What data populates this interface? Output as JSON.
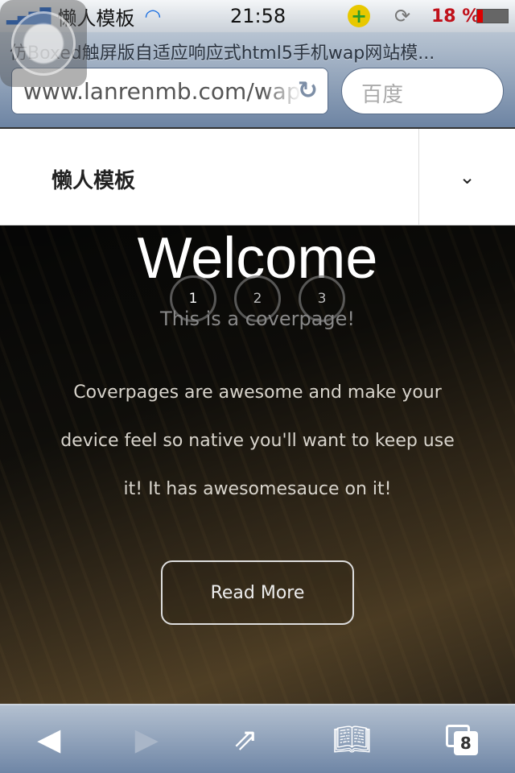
{
  "status": {
    "carrier": "懒人模板",
    "time": "21:58",
    "battery": "18 %",
    "icons": [
      "signal-icon",
      "wifi-icon",
      "360-icon",
      "rotation-lock-icon",
      "battery-icon"
    ]
  },
  "browser": {
    "title": "仿Boxed触屏版自适应响应式html5手机wap网站模...",
    "url": "www.lanrenmb.com/wap",
    "search_placeholder": "百度",
    "tab_count": "8"
  },
  "nav": {
    "logo": "懒人模板",
    "menu_icon": "chevron-down-icon"
  },
  "hero": {
    "title": "Welcome",
    "slides": [
      "1",
      "2",
      "3"
    ],
    "active_slide": 1,
    "subtitle": "This is a coverpage!",
    "paragraph": "Coverpages are awesome and make your device feel so native you'll want to keep use it! It has awesomesauce on it!",
    "button": "Read More"
  }
}
